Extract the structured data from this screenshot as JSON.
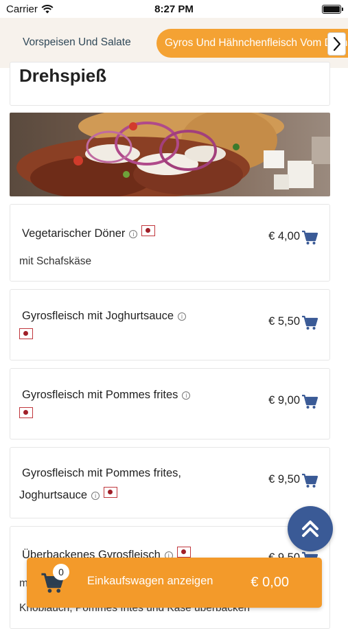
{
  "status_bar": {
    "carrier": "Carrier",
    "time": "8:27 PM"
  },
  "tabs": [
    {
      "label": "Vorspeisen Und Salate",
      "active": false
    },
    {
      "label": "Gyros Und Hähnchenfleisch Vom Drehspieß",
      "active": true
    }
  ],
  "section": {
    "title": "Drehspieß"
  },
  "items": [
    {
      "name": "Vegetarischer Döner",
      "price": "€ 4,00",
      "description": "mit Schafskäse"
    },
    {
      "name": "Gyrosfleisch mit Joghurtsauce",
      "price": "€ 5,50"
    },
    {
      "name": "Gyrosfleisch mit Pommes frites",
      "price": "€ 9,00"
    },
    {
      "name_line1": "Gyrosfleisch mit Pommes frites,",
      "name_line2": "Joghurtsauce",
      "price": "€ 9,50"
    },
    {
      "name": "Überbackenes Gyrosfleisch",
      "price": "€ 9,50",
      "description_start": "m",
      "description_bottom": "Knoblauch, Pommes frites und Käse überbacken"
    }
  ],
  "cart": {
    "count": "0",
    "label": "Einkaufswagen anzeigen",
    "total": "€ 0,00"
  },
  "colors": {
    "accent": "#f39a2a",
    "primary": "#3a5a96",
    "tab_text": "#2f4858",
    "tab_bar_bg": "#f7f2ec"
  },
  "icons": [
    "wifi-icon",
    "battery-icon",
    "chevron-right-icon",
    "info-icon",
    "flag-icon",
    "cart-icon",
    "double-chevron-up-icon"
  ]
}
